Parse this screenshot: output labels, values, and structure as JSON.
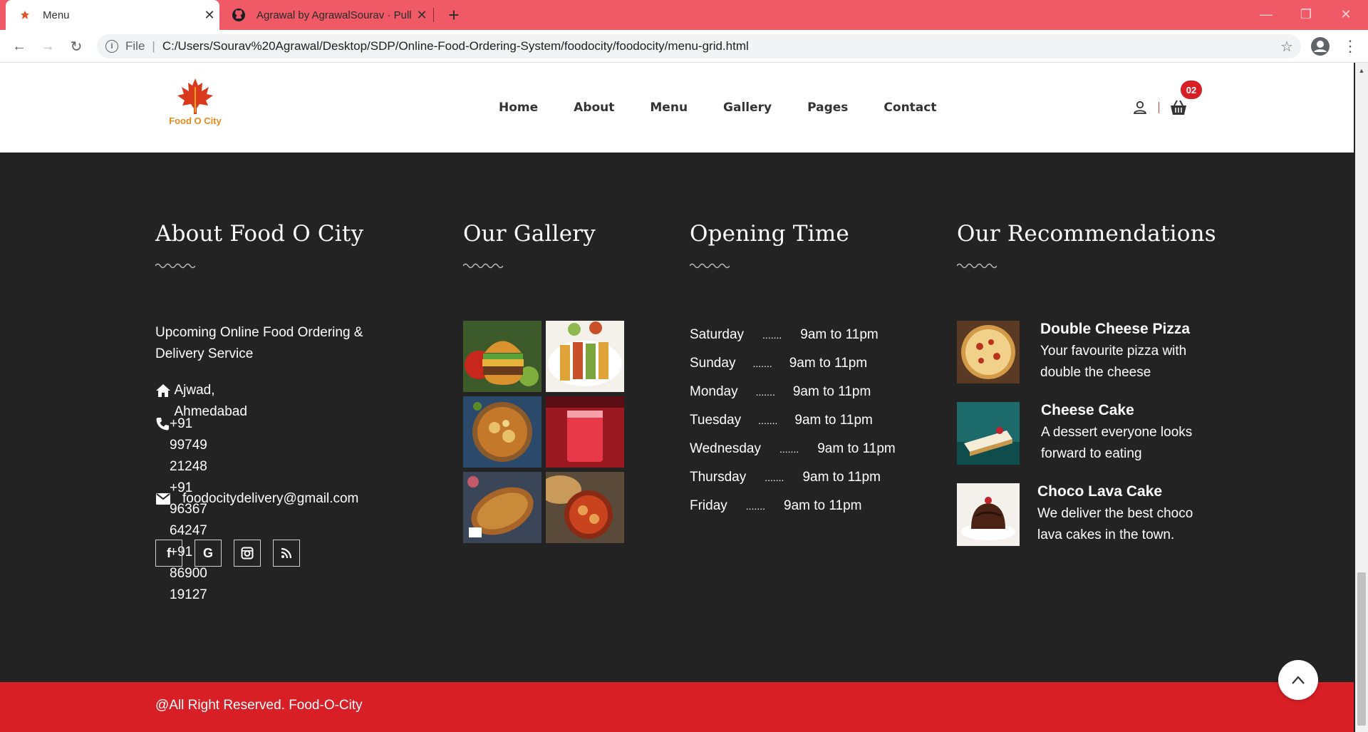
{
  "browser": {
    "tabs": [
      {
        "title": "Menu",
        "active": true
      },
      {
        "title": "Agrawal by AgrawalSourav · Pull",
        "active": false
      }
    ],
    "address": {
      "scheme": "File",
      "url": "C:/Users/Sourav%20Agrawal/Desktop/SDP/Online-Food-Ordering-System/foodocity/foodocity/menu-grid.html"
    },
    "colors": {
      "tabstrip": "#f05a66"
    }
  },
  "header": {
    "logo_text": "Food O City",
    "nav": [
      "Home",
      "About",
      "Menu",
      "Gallery",
      "Pages",
      "Contact"
    ],
    "cart_count": "02"
  },
  "footer": {
    "about": {
      "title": "About Food O City",
      "text": "Upcoming Online Food Ordering & Delivery Service",
      "address": "Ajwad, Ahmedabad",
      "phones": [
        "+91 99749 21248",
        "+91 96367 64247",
        "+91 86900 19127"
      ],
      "email": "foodocitydelivery@gmail.com",
      "socials": [
        "facebook-icon",
        "google-icon",
        "instagram-icon",
        "rss-icon"
      ]
    },
    "gallery": {
      "title": "Our Gallery",
      "images": [
        "burger",
        "paneer-tikka",
        "curry-bowl",
        "red-drink",
        "fried-rice",
        "chicken-curry"
      ]
    },
    "opening": {
      "title": "Opening Time",
      "rows": [
        {
          "day": "Saturday",
          "dots": ".......",
          "time": "9am to 11pm"
        },
        {
          "day": "Sunday",
          "dots": ".......",
          "time": "9am to 11pm"
        },
        {
          "day": "Monday",
          "dots": ".......",
          "time": "9am to 11pm"
        },
        {
          "day": "Tuesday",
          "dots": ".......",
          "time": "9am to 11pm"
        },
        {
          "day": "Wednesday",
          "dots": ".......",
          "time": "9am to 11pm"
        },
        {
          "day": "Thursday",
          "dots": ".......",
          "time": "9am to 11pm"
        },
        {
          "day": "Friday",
          "dots": ".......",
          "time": "9am to 11pm"
        }
      ]
    },
    "recommendations": {
      "title": "Our Recommendations",
      "items": [
        {
          "name": "Double Cheese Pizza",
          "desc": "Your favourite pizza with double the cheese"
        },
        {
          "name": "Cheese Cake",
          "desc": "A dessert everyone looks forward to eating"
        },
        {
          "name": "Choco Lava Cake",
          "desc": "We deliver the best choco lava cakes in the town."
        }
      ]
    },
    "copyright": "@All Right Reserved. Food-O-City",
    "colors": {
      "footer_bg": "#232323",
      "accent_red": "#d81f26"
    }
  }
}
